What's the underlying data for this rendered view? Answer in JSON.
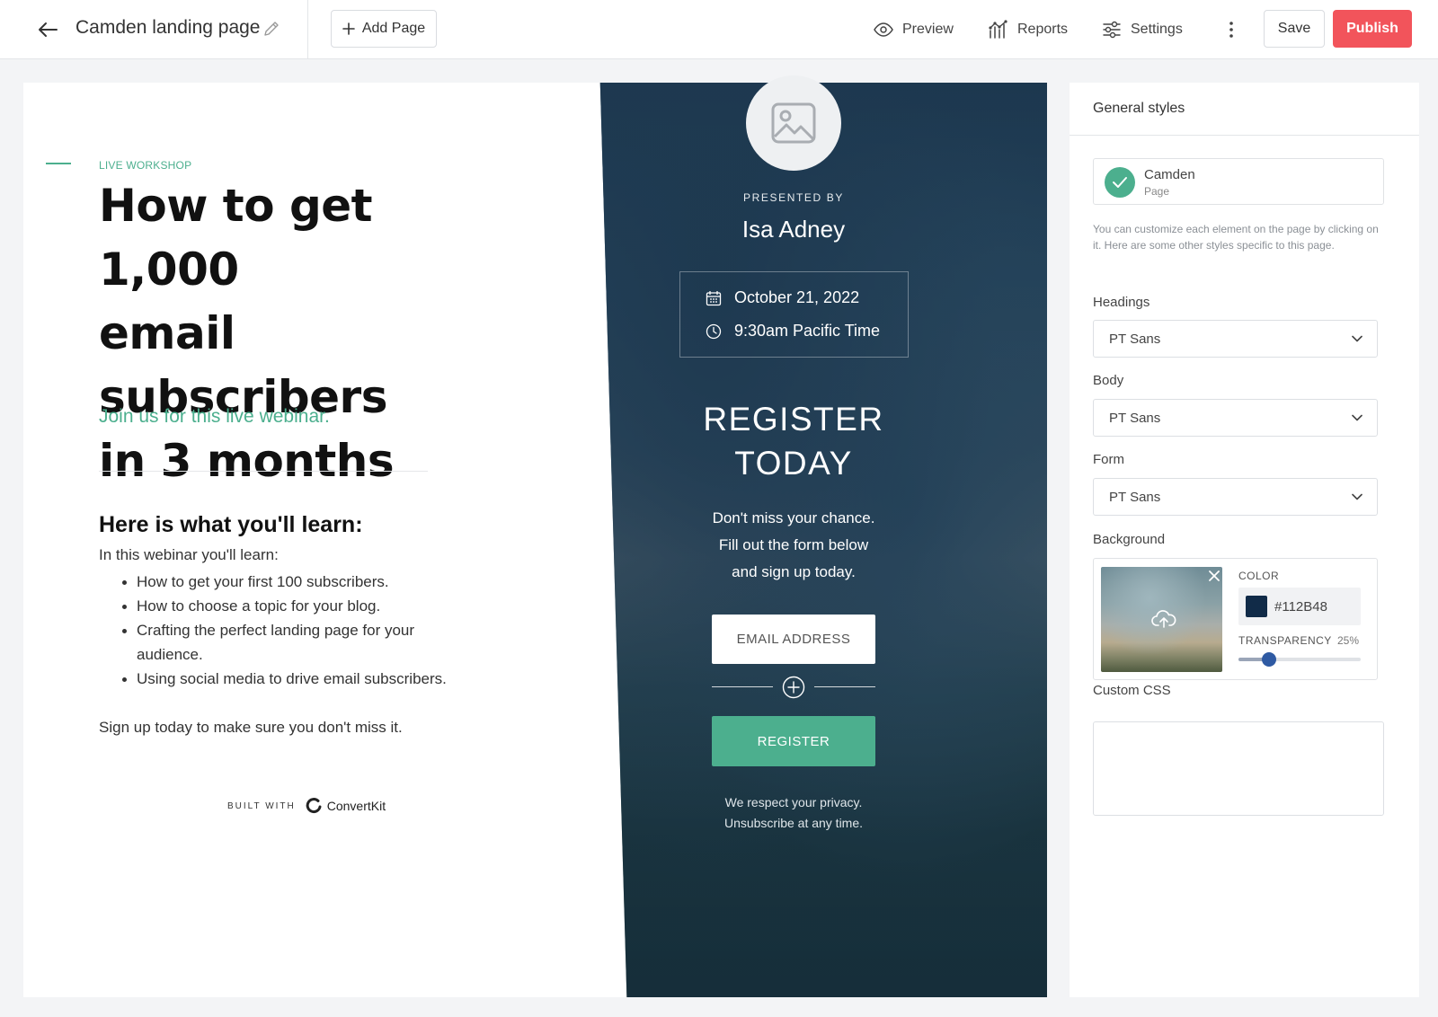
{
  "topbar": {
    "page_title": "Camden landing page",
    "add_page_label": "Add Page",
    "nav": {
      "preview": "Preview",
      "reports": "Reports",
      "settings": "Settings"
    },
    "save_label": "Save",
    "publish_label": "Publish",
    "publish_color": "#f2545b"
  },
  "landing": {
    "eyebrow": "LIVE WORKSHOP",
    "headline_lines": [
      "How to get 1,000",
      "email subscribers",
      "in 3 months"
    ],
    "lede": "Join us for this live webinar.",
    "learn_heading": "Here is what you'll learn:",
    "learn_intro": "In this webinar you'll learn:",
    "learn_items": [
      "How to get your first 100 subscribers.",
      "How to choose a topic for your blog.",
      "Crafting the perfect landing page for your audience.",
      "Using social media to drive email subscribers."
    ],
    "learn_outro": "Sign up today to make sure you don't miss it.",
    "built_with_label": "BUILT WITH",
    "built_with_brand": "ConvertKit",
    "accent_color": "#4caf8e"
  },
  "panel": {
    "presented_by": "PRESENTED BY",
    "presenter": "Isa Adney",
    "date": "October 21, 2022",
    "time": "9:30am Pacific Time",
    "register_heading_lines": [
      "REGISTER",
      "TODAY"
    ],
    "copy_lines": [
      "Don't miss your chance.",
      "Fill out the form below",
      "and sign up today."
    ],
    "email_placeholder": "EMAIL ADDRESS",
    "register_button": "REGISTER",
    "privacy_lines": [
      "We respect your privacy.",
      "Unsubscribe at any time."
    ]
  },
  "sidebar": {
    "title": "General styles",
    "theme_name": "Camden",
    "theme_sub": "Page",
    "note": "You can customize each element on the page by clicking on it. Here are some other styles specific to this page.",
    "headings_label": "Headings",
    "headings_value": "PT Sans",
    "body_label": "Body",
    "body_value": "PT Sans",
    "form_label": "Form",
    "form_value": "PT Sans",
    "background_label": "Background",
    "color_label": "COLOR",
    "color_hex": "#112B48",
    "transparency_label": "TRANSPARENCY",
    "transparency_value": "25%",
    "transparency_fraction": 0.25,
    "custom_css_label": "Custom CSS",
    "custom_css_value": ""
  }
}
